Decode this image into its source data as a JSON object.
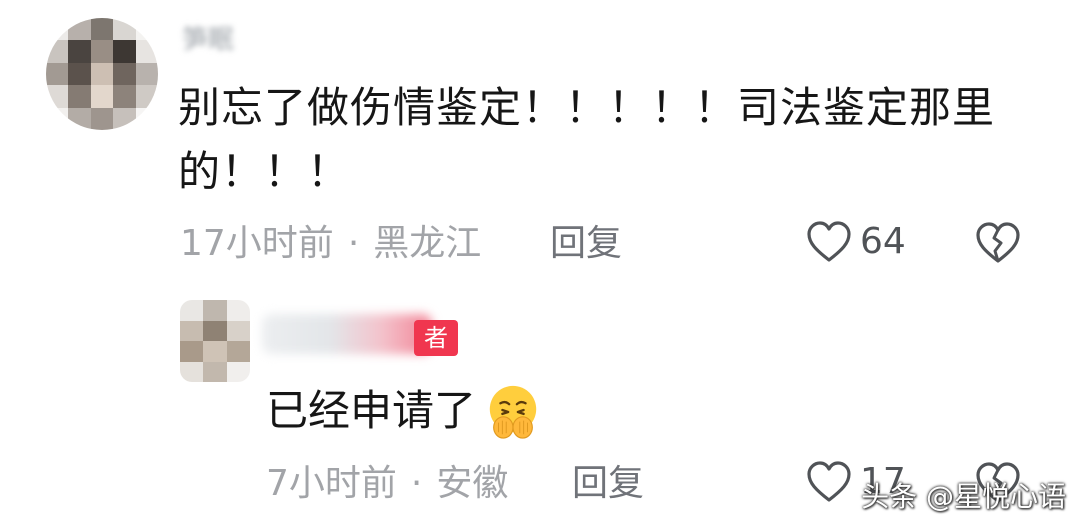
{
  "comments": [
    {
      "username": "笋眠",
      "text": "别忘了做伤情鉴定！！！！！司法鉴定那里的！！！",
      "time": "17小时前",
      "location": "黑龙江",
      "reply_label": "回复",
      "likes": "64"
    },
    {
      "author_badge": "者",
      "text": "已经申请了",
      "emoji": "pleading-hands-emoji",
      "time": "7小时前",
      "location": "安徽",
      "reply_label": "回复",
      "likes": "17"
    }
  ],
  "separator": "·",
  "watermark": "头条 @星悦心语",
  "icons": {
    "like": "heart-outline-icon",
    "dislike": "broken-heart-icon"
  },
  "colors": {
    "text": "#161616",
    "meta": "#a2a4a8",
    "badge": "#f0364f"
  }
}
